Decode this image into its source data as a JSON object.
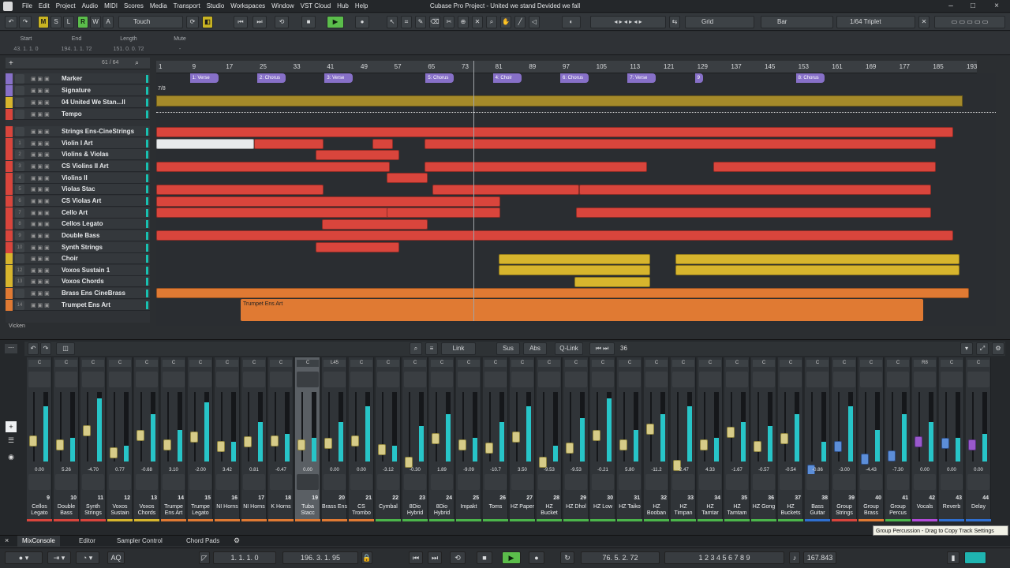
{
  "window": {
    "title": "Cubase Pro Project - United we stand Devided we fall"
  },
  "menu": [
    "File",
    "Edit",
    "Project",
    "Audio",
    "MIDI",
    "Scores",
    "Media",
    "Transport",
    "Studio",
    "Workspaces",
    "Window",
    "VST Cloud",
    "Hub",
    "Help"
  ],
  "toolbar": {
    "automation_mode": "Touch",
    "snap_type": "Grid",
    "grid_type": "Bar",
    "quantize": "1/64 Triplet",
    "m_label": "M",
    "s_label": "S",
    "l_label": "L",
    "r_label": "R",
    "w_label": "W",
    "a_label": "A"
  },
  "infoline": {
    "start_label": "Start",
    "end_label": "End",
    "length_label": "Length",
    "mute_label": "Mute",
    "start_value": "43. 1. 1. 0",
    "end_value": "194. 1. 1. 72",
    "length_value": "151. 0. 0. 72",
    "mute_value": "-"
  },
  "tracklist": {
    "count": "61 / 64",
    "footer_label": "Vicken",
    "tracks": [
      {
        "num": "",
        "name": "Marker",
        "color": "#8770c8"
      },
      {
        "num": "",
        "name": "Signature",
        "color": "#8770c8"
      },
      {
        "num": "",
        "name": "04 United We Stan...ll",
        "color": "#d7b52d"
      },
      {
        "num": "",
        "name": "Tempo",
        "color": "#d9453c"
      },
      {
        "num": "",
        "name": "Strings Ens-CineStrings",
        "color": "#d9453c"
      },
      {
        "num": "1",
        "name": "Violin I Art",
        "color": "#d9453c"
      },
      {
        "num": "2",
        "name": "Violins & Violas",
        "color": "#d9453c"
      },
      {
        "num": "3",
        "name": "CS Violins II Art",
        "color": "#d9453c"
      },
      {
        "num": "4",
        "name": "Violins II",
        "color": "#d9453c"
      },
      {
        "num": "5",
        "name": "Violas Stac",
        "color": "#d9453c"
      },
      {
        "num": "6",
        "name": "CS Violas Art",
        "color": "#d9453c"
      },
      {
        "num": "7",
        "name": "Cello Art",
        "color": "#d9453c"
      },
      {
        "num": "8",
        "name": "Cellos Legato",
        "color": "#d9453c"
      },
      {
        "num": "9",
        "name": "Double Bass",
        "color": "#d9453c"
      },
      {
        "num": "10",
        "name": "Synth Strings",
        "color": "#d9453c"
      },
      {
        "num": "",
        "name": "Choir",
        "color": "#d7b52d"
      },
      {
        "num": "12",
        "name": "Voxos Sustain 1",
        "color": "#d7b52d"
      },
      {
        "num": "13",
        "name": "Voxos Chords",
        "color": "#d7b52d"
      },
      {
        "num": "",
        "name": "Brass Ens CineBrass",
        "color": "#e07a33"
      },
      {
        "num": "14",
        "name": "Trumpet Ens Art",
        "color": "#e07a33"
      }
    ]
  },
  "ruler": [
    "1",
    "9",
    "17",
    "25",
    "33",
    "41",
    "49",
    "57",
    "65",
    "73",
    "81",
    "89",
    "97",
    "105",
    "113",
    "121",
    "129",
    "137",
    "145",
    "153",
    "161",
    "169",
    "177",
    "185",
    "193"
  ],
  "markers": [
    {
      "label": "1: Verse"
    },
    {
      "label": "2: Chorus"
    },
    {
      "label": "3: Verse"
    },
    {
      "label": "5: Chorus"
    },
    {
      "label": "4: Choir"
    },
    {
      "label": "6: Chorus"
    },
    {
      "label": "7: Verse"
    },
    {
      "label": "9"
    },
    {
      "label": "8: Chorus"
    }
  ],
  "signature_value": "7/8",
  "trumpet_part_label": "Trumpet Ens Art",
  "mixer": {
    "link_label": "Link",
    "sus_label": "Sus",
    "abs_label": "Abs",
    "qlink_label": "Q-Link",
    "count": "36",
    "pan_labels": [
      "C",
      "C",
      "C",
      "C",
      "C",
      "C",
      "C",
      "C",
      "C",
      "C",
      "C",
      "L45",
      "C",
      "C",
      "C",
      "C",
      "C",
      "C",
      "C",
      "C",
      "C",
      "C",
      "C",
      "C",
      "C",
      "C",
      "C",
      "C",
      "C",
      "C",
      "C",
      "C",
      "C",
      "R8",
      "C",
      "C",
      "C"
    ],
    "channels": [
      {
        "num": "9",
        "name": "Cellos Legato",
        "vol": "0.00",
        "color": "#d9453c"
      },
      {
        "num": "10",
        "name": "Double Bass",
        "vol": "5.26",
        "color": "#d9453c"
      },
      {
        "num": "11",
        "name": "Synth Strings",
        "vol": "-4.70",
        "color": "#d9453c"
      },
      {
        "num": "12",
        "name": "Voxos Sustain",
        "vol": "0.77",
        "color": "#d7b52d"
      },
      {
        "num": "13",
        "name": "Voxos Chords",
        "vol": "-0.68",
        "color": "#d7b52d"
      },
      {
        "num": "14",
        "name": "Trumpe Ens Art",
        "vol": "3.10",
        "color": "#e07a33"
      },
      {
        "num": "15",
        "name": "Trumpe Legato",
        "vol": "-2.00",
        "color": "#e07a33"
      },
      {
        "num": "16",
        "name": "NI Horns",
        "vol": "3.42",
        "color": "#e07a33"
      },
      {
        "num": "17",
        "name": "NI Horns",
        "vol": "0.81",
        "color": "#e07a33"
      },
      {
        "num": "18",
        "name": "K Horns",
        "vol": "-0.47",
        "color": "#e07a33"
      },
      {
        "num": "19",
        "name": "Tuba Stacc",
        "vol": "0.00",
        "color": "#e07a33"
      },
      {
        "num": "20",
        "name": "Brass Ens",
        "vol": "0.00",
        "color": "#e07a33"
      },
      {
        "num": "21",
        "name": "CS Trombo",
        "vol": "0.00",
        "color": "#e07a33"
      },
      {
        "num": "22",
        "name": "Cymbal",
        "vol": "-3.12",
        "color": "#4bb54b"
      },
      {
        "num": "23",
        "name": "8Dio Hybrid",
        "vol": "-0.30",
        "color": "#4bb54b"
      },
      {
        "num": "24",
        "name": "8Dio Hybrid",
        "vol": "1.89",
        "color": "#4bb54b"
      },
      {
        "num": "25",
        "name": "Impakt",
        "vol": "-9.09",
        "color": "#4bb54b"
      },
      {
        "num": "26",
        "name": "Toms",
        "vol": "-10.7",
        "color": "#4bb54b"
      },
      {
        "num": "27",
        "name": "HZ Paper",
        "vol": "3.50",
        "color": "#4bb54b"
      },
      {
        "num": "28",
        "name": "HZ Bucket",
        "vol": "-9.53",
        "color": "#4bb54b"
      },
      {
        "num": "29",
        "name": "HZ Dhol",
        "vol": "-9.53",
        "color": "#4bb54b"
      },
      {
        "num": "30",
        "name": "HZ Low",
        "vol": "-0.21",
        "color": "#4bb54b"
      },
      {
        "num": "31",
        "name": "HZ Taiko",
        "vol": "5.80",
        "color": "#4bb54b"
      },
      {
        "num": "32",
        "name": "HZ Booban",
        "vol": "-11.2",
        "color": "#4bb54b"
      },
      {
        "num": "33",
        "name": "HZ Timpan",
        "vol": "-2.47",
        "color": "#4bb54b"
      },
      {
        "num": "34",
        "name": "HZ Tamtar",
        "vol": "4.33",
        "color": "#4bb54b"
      },
      {
        "num": "35",
        "name": "HZ Tamtam",
        "vol": "-1.67",
        "color": "#4bb54b"
      },
      {
        "num": "36",
        "name": "HZ Gong",
        "vol": "-0.57",
        "color": "#4bb54b"
      },
      {
        "num": "37",
        "name": "HZ Buckets",
        "vol": "-0.54",
        "color": "#4bb54b"
      },
      {
        "num": "38",
        "name": "Bass Guitar",
        "vol": "-0.86",
        "color": "#2f6fd0"
      },
      {
        "num": "39",
        "name": "Group Strings",
        "vol": "-3.00",
        "color": "#d9453c"
      },
      {
        "num": "40",
        "name": "Group Brass",
        "vol": "-4.43",
        "color": "#e07a33"
      },
      {
        "num": "41",
        "name": "Group Percus",
        "vol": "-7.30",
        "color": "#4bb54b"
      },
      {
        "num": "42",
        "name": "Vocals",
        "vol": "0.00",
        "color": "#b24ad9"
      },
      {
        "num": "43",
        "name": "Reverb",
        "vol": "0.00",
        "color": "#2f6fd0"
      },
      {
        "num": "44",
        "name": "Delay",
        "vol": "0.00",
        "color": "#2f6fd0"
      }
    ]
  },
  "bottom_tabs": [
    "MixConsole",
    "Editor",
    "Sampler Control",
    "Chord Pads"
  ],
  "transport": {
    "left_locator": "1. 1. 1. 0",
    "right_locator": "196. 3. 1. 95",
    "position": "76. 5. 2. 72",
    "tempo": "167.843"
  },
  "tooltip": "Group Percussion - Drag to Copy Track Settings"
}
